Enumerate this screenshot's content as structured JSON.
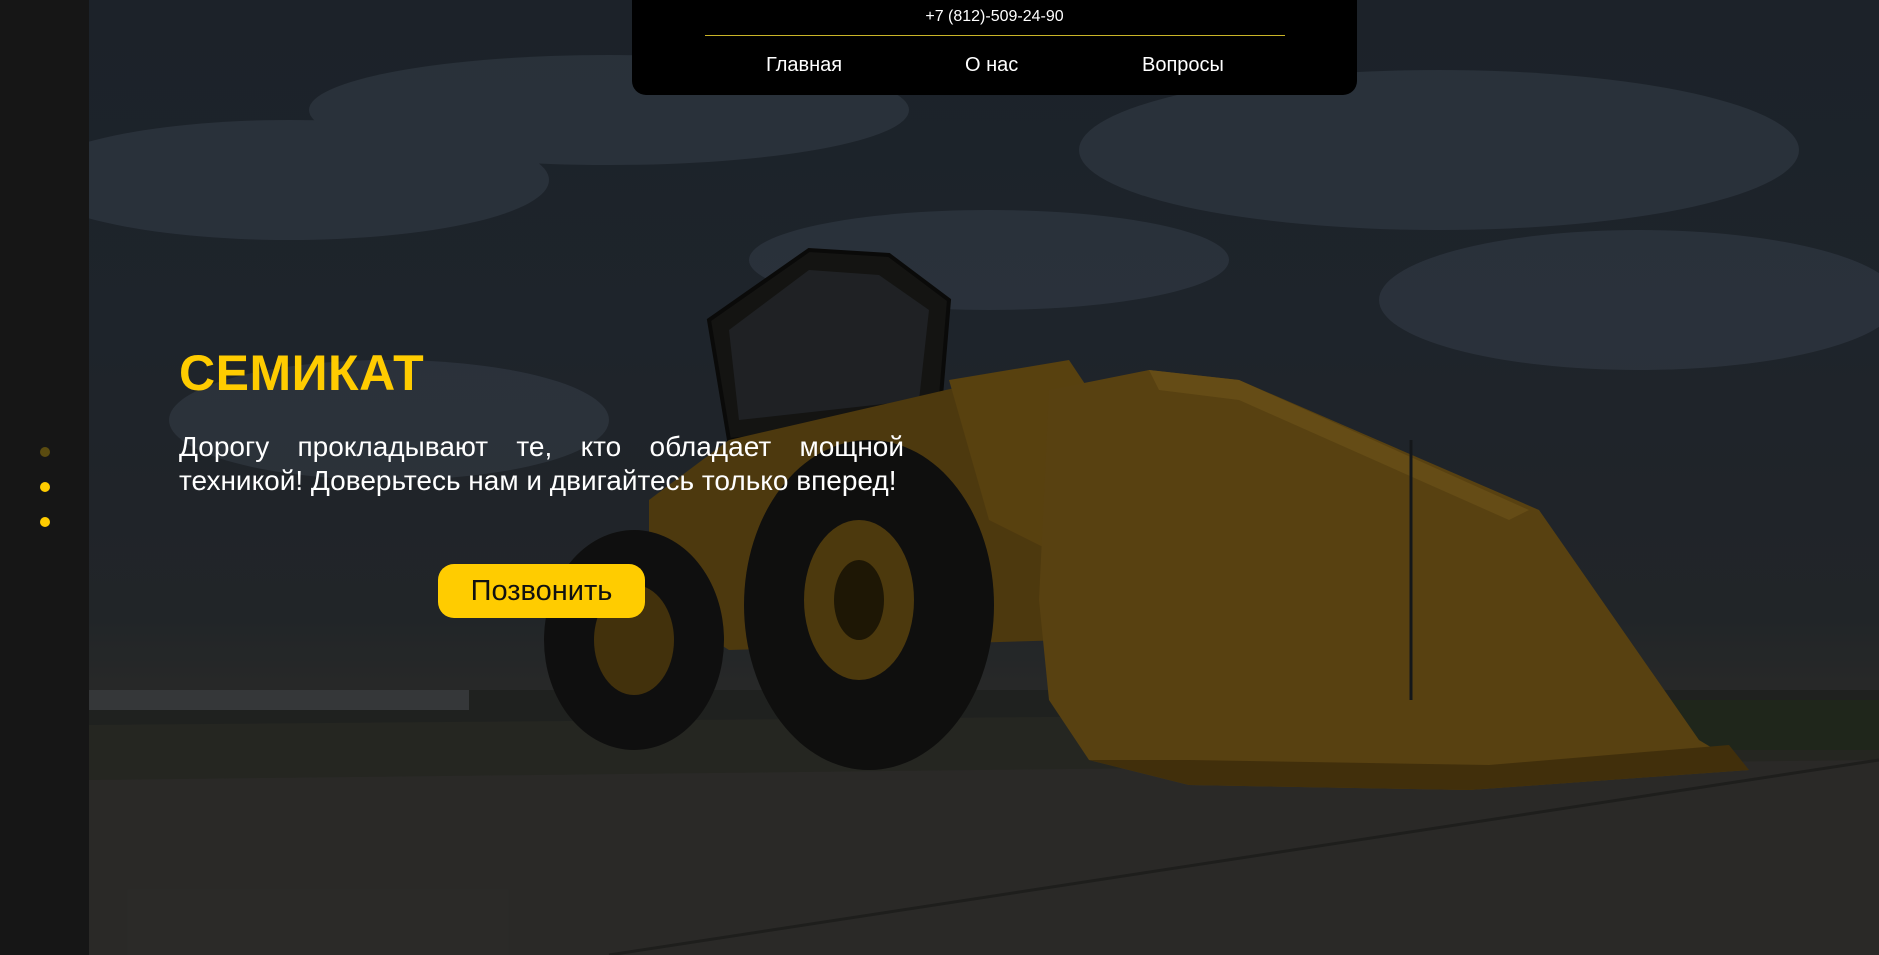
{
  "header": {
    "phone": "+7 (812)-509-24-90",
    "nav": [
      {
        "label": "Главная"
      },
      {
        "label": "О нас"
      },
      {
        "label": "Вопросы"
      }
    ]
  },
  "hero": {
    "title": "СЕМИКАТ",
    "text": "Дорогу прокладывают те, кто обладает мощной техникой! Доверьтесь нам и двигайтесь только вперед!",
    "button_label": "Позвонить",
    "image": "wheel-loader-photo"
  },
  "slider": {
    "dots": 3,
    "active_index": 0
  },
  "colors": {
    "accent": "#ffcc00",
    "header_bg": "#000000",
    "sidebar_bg": "#161616"
  }
}
